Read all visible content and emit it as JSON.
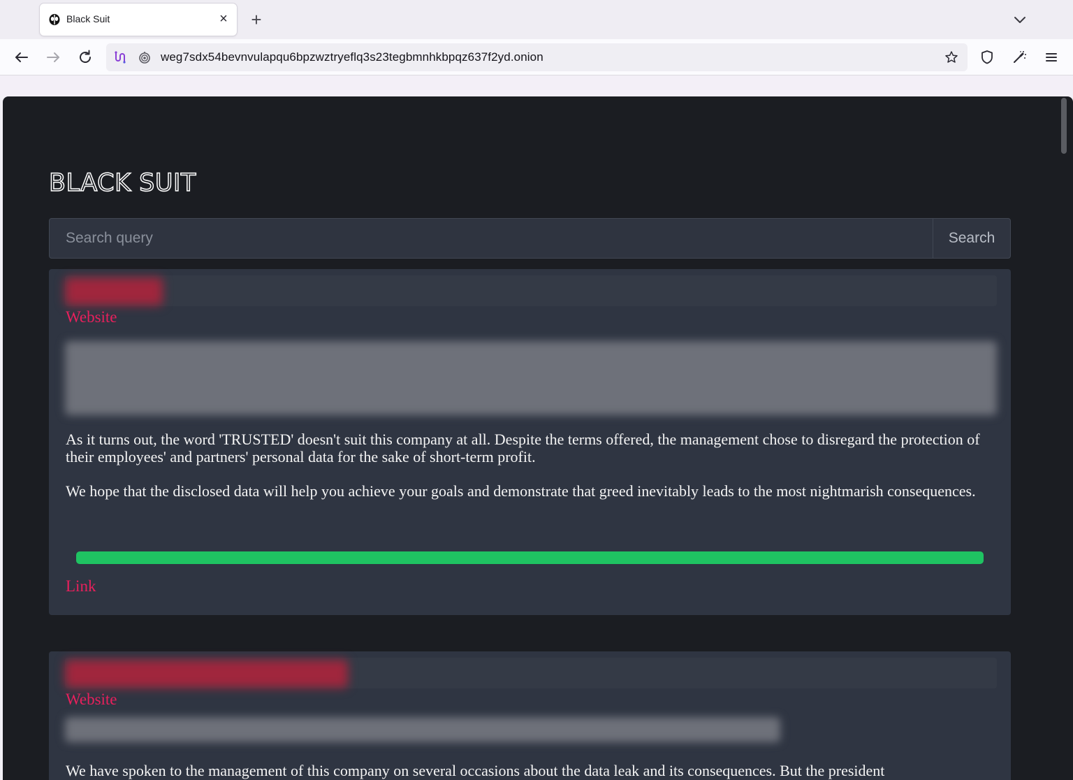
{
  "browser": {
    "tab": {
      "title": "Black Suit",
      "favicon": "black-suit-skull-icon"
    },
    "new_tab_label": "+",
    "close_label": "×",
    "url": "weg7sdx54bevnvulapqu6bpzwztryeflq3s23tegbmnhkbpqz637f2yd.onion",
    "icons": [
      "back-arrow-icon",
      "forward-arrow-icon",
      "reload-icon",
      "tor-circuit-icon",
      "onion-lock-icon",
      "star-icon",
      "shield-icon",
      "new-identity-icon",
      "menu-icon",
      "tab-list-chevron-icon"
    ]
  },
  "site": {
    "title": "BLACK SUIT",
    "search": {
      "placeholder": "Search query",
      "button_label": "Search"
    }
  },
  "posts": [
    {
      "name_redacted": true,
      "website_label": "Website",
      "description_redacted": true,
      "paragraphs": [
        "As it turns out, the word 'TRUSTED' doesn't suit this company at all. Despite the terms offered, the management chose to disregard the protection of their employees' and partners' personal data for the sake of short-term profit.",
        "We hope that the disclosed data will help you achieve your goals and demonstrate that greed inevitably leads to the most nightmarish consequences."
      ],
      "progress": 1.0,
      "link_label": "Link"
    },
    {
      "name_redacted": true,
      "website_label": "Website",
      "description_redacted": true,
      "paragraphs": [
        "We have spoken to the management of this company on several occasions about the data leak and its consequences. But the president"
      ]
    }
  ],
  "colors": {
    "page_bg": "#1b1d22",
    "card_bg": "#2f3542",
    "link": "#e8205c",
    "progress": "#1fc362",
    "text": "#f4f4f4"
  }
}
